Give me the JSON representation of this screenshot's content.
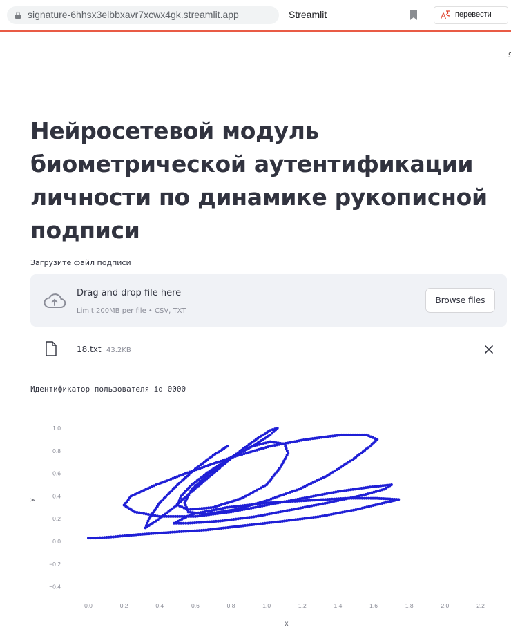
{
  "browser": {
    "url": "signature-6hhsx3elbbxavr7xcwx4gk.streamlit.app",
    "tab_title": "Streamlit",
    "translate_label": "перевести",
    "right_edge_char": "s"
  },
  "app": {
    "title": "Нейросетевой модуль биометрической аутентификации личности по динамике рукописной подписи",
    "uploader": {
      "label": "Загрузите файл подписи",
      "drop_text": "Drag and drop file here",
      "limit_text": "Limit 200MB per file • CSV, TXT",
      "browse_label": "Browse files"
    },
    "uploaded_file": {
      "name": "18.txt",
      "size": "43.2KB"
    },
    "user_id_text": "Идентификатор пользователя id 0000"
  },
  "colors": {
    "accent": "#1f1fd6",
    "streamlit_red": "#e95b45",
    "dropzone_bg": "#f0f2f6"
  },
  "icons": {
    "url_bar": "lock-icon",
    "bookmark": "bookmark-icon",
    "translate": "translate-icon",
    "upload": "cloud-upload-icon",
    "file": "file-icon",
    "remove": "close-icon"
  },
  "chart_data": {
    "type": "scatter",
    "title": "",
    "xlabel": "x",
    "ylabel": "y",
    "xlim": [
      -0.1,
      2.25
    ],
    "ylim": [
      -0.45,
      1.05
    ],
    "x_ticks": [
      "0.0",
      "0.2",
      "0.4",
      "0.6",
      "0.8",
      "1.0",
      "1.2",
      "1.4",
      "1.6",
      "1.8",
      "2.0",
      "2.2"
    ],
    "y_ticks": [
      "1.0",
      "0.8",
      "0.6",
      "0.4",
      "0.2",
      "0.0",
      "−0.2",
      "−0.4"
    ],
    "grid": false,
    "legend": "none",
    "color": "#1f1fd6",
    "series": [
      {
        "points": [
          [
            0.78,
            0.84
          ],
          [
            0.7,
            0.76
          ],
          [
            0.6,
            0.64
          ],
          [
            0.5,
            0.5
          ],
          [
            0.4,
            0.34
          ],
          [
            0.34,
            0.2
          ],
          [
            0.32,
            0.12
          ],
          [
            0.38,
            0.18
          ],
          [
            0.48,
            0.3
          ],
          [
            0.58,
            0.44
          ],
          [
            0.7,
            0.6
          ],
          [
            0.82,
            0.76
          ],
          [
            0.94,
            0.9
          ],
          [
            1.02,
            0.98
          ],
          [
            1.06,
            1.0
          ],
          [
            1.02,
            0.94
          ],
          [
            0.92,
            0.84
          ],
          [
            0.8,
            0.74
          ],
          [
            0.68,
            0.62
          ],
          [
            0.58,
            0.5
          ],
          [
            0.52,
            0.4
          ],
          [
            0.5,
            0.32
          ],
          [
            0.56,
            0.28
          ],
          [
            0.7,
            0.3
          ],
          [
            0.86,
            0.38
          ],
          [
            1.0,
            0.5
          ],
          [
            1.08,
            0.66
          ],
          [
            1.12,
            0.78
          ],
          [
            1.1,
            0.86
          ],
          [
            1.02,
            0.88
          ],
          [
            0.92,
            0.84
          ],
          [
            0.8,
            0.74
          ],
          [
            0.68,
            0.6
          ],
          [
            0.58,
            0.46
          ],
          [
            0.54,
            0.34
          ],
          [
            0.56,
            0.26
          ],
          [
            0.66,
            0.24
          ],
          [
            0.82,
            0.28
          ],
          [
            1.0,
            0.36
          ],
          [
            1.18,
            0.46
          ],
          [
            1.34,
            0.58
          ],
          [
            1.48,
            0.72
          ],
          [
            1.58,
            0.84
          ],
          [
            1.62,
            0.9
          ],
          [
            1.56,
            0.94
          ],
          [
            1.42,
            0.94
          ],
          [
            1.22,
            0.9
          ],
          [
            1.02,
            0.84
          ],
          [
            0.8,
            0.74
          ],
          [
            0.58,
            0.62
          ],
          [
            0.38,
            0.5
          ],
          [
            0.24,
            0.4
          ],
          [
            0.2,
            0.32
          ],
          [
            0.26,
            0.26
          ],
          [
            0.4,
            0.22
          ],
          [
            0.6,
            0.22
          ],
          [
            0.8,
            0.26
          ],
          [
            1.0,
            0.32
          ],
          [
            1.2,
            0.38
          ],
          [
            1.4,
            0.44
          ],
          [
            1.58,
            0.48
          ],
          [
            1.7,
            0.5
          ],
          [
            1.66,
            0.46
          ],
          [
            1.52,
            0.4
          ],
          [
            1.34,
            0.34
          ],
          [
            1.14,
            0.28
          ],
          [
            0.94,
            0.22
          ],
          [
            0.74,
            0.18
          ],
          [
            0.56,
            0.16
          ],
          [
            0.48,
            0.16
          ],
          [
            0.58,
            0.24
          ],
          [
            0.78,
            0.3
          ],
          [
            1.0,
            0.34
          ],
          [
            1.22,
            0.36
          ],
          [
            1.44,
            0.38
          ],
          [
            1.62,
            0.38
          ],
          [
            1.74,
            0.37
          ],
          [
            1.66,
            0.34
          ],
          [
            1.5,
            0.28
          ],
          [
            1.3,
            0.22
          ],
          [
            1.1,
            0.18
          ],
          [
            0.88,
            0.14
          ],
          [
            0.66,
            0.1
          ],
          [
            0.46,
            0.08
          ],
          [
            0.28,
            0.06
          ],
          [
            0.14,
            0.04
          ],
          [
            0.04,
            0.03
          ],
          [
            0.0,
            0.03
          ]
        ]
      }
    ]
  }
}
